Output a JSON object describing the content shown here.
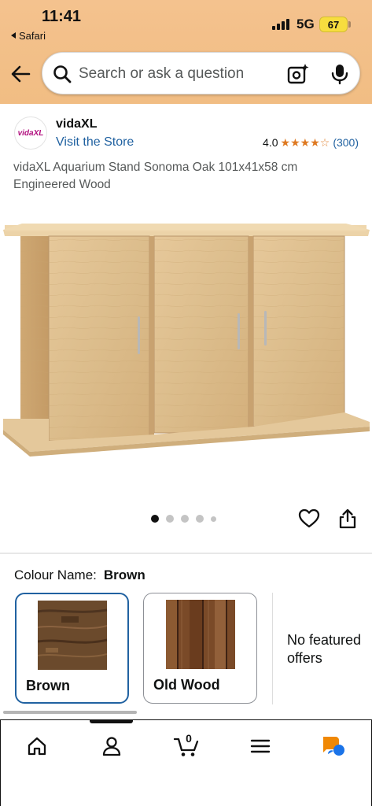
{
  "status_bar": {
    "time": "11:41",
    "back_app": "Safari",
    "network": "5G",
    "battery": "67"
  },
  "search": {
    "placeholder": "Search or ask a question"
  },
  "icons": {
    "back": "back-arrow-icon",
    "search": "search-icon",
    "camera": "camera-lens-icon",
    "mic": "microphone-icon",
    "heart": "heart-icon",
    "share": "share-icon",
    "home": "home-icon",
    "account": "account-icon",
    "cart": "cart-icon",
    "menu": "menu-icon",
    "assistant": "rufus-assistant-icon"
  },
  "brand": {
    "logo_text": "vidaXL",
    "name": "vidaXL",
    "store_link": "Visit the Store",
    "rating": "4.0",
    "stars": 4,
    "max_stars": 5,
    "rating_count": "(300)"
  },
  "product": {
    "title": "vidaXL Aquarium Stand Sonoma Oak 101x41x58 cm Engineered Wood"
  },
  "carousel": {
    "count": 5,
    "active_index": 0
  },
  "colour": {
    "label": "Colour Name:",
    "selected": "Brown",
    "options": [
      {
        "label": "Brown",
        "selected": true
      },
      {
        "label": "Old Wood",
        "selected": false
      }
    ],
    "offers_text": "No featured offers"
  },
  "bottom_nav": {
    "cart_count": "0",
    "active": "account"
  },
  "colors": {
    "header_bg": "#f3c08a",
    "link": "#2162a1",
    "star": "#de7921",
    "selected_border": "#2162a1",
    "battery": "#f7dd3f"
  }
}
